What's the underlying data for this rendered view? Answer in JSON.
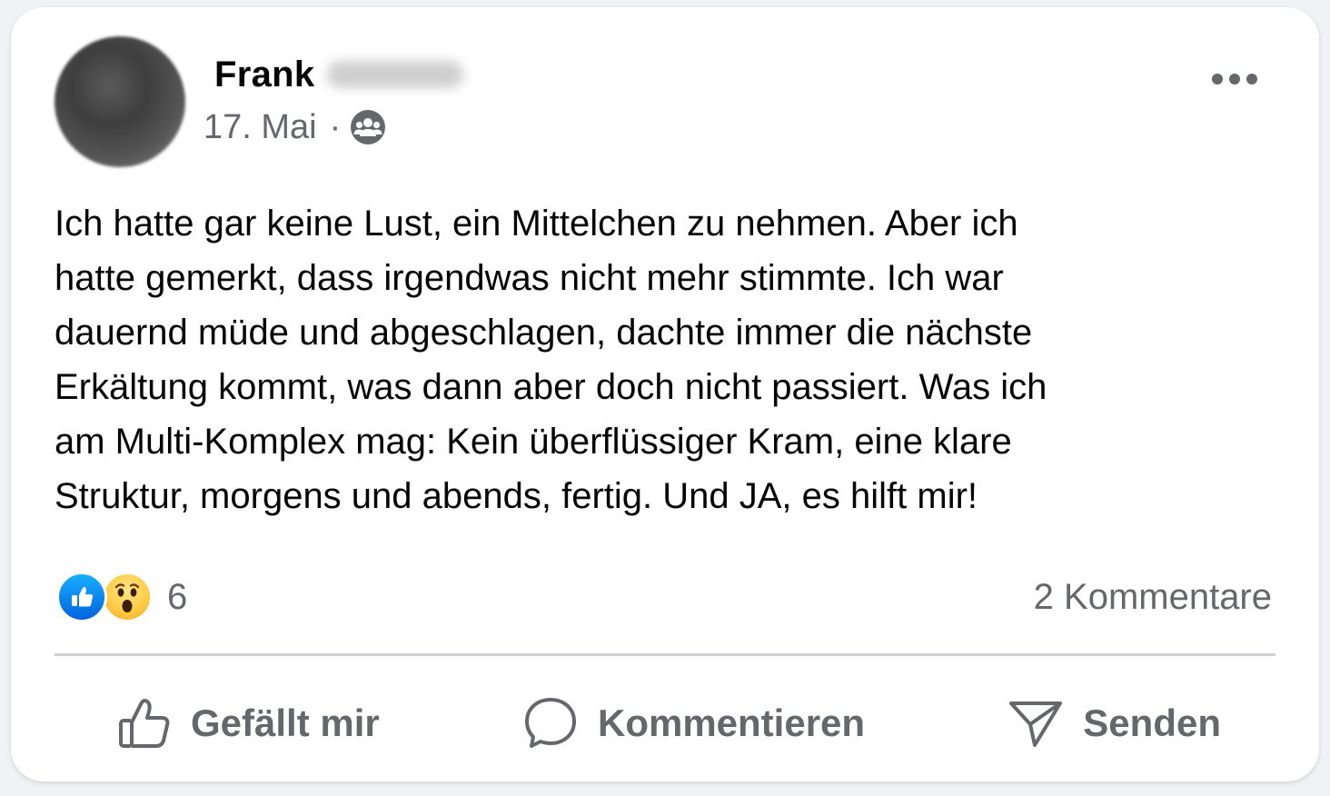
{
  "post": {
    "author_name": "Frank",
    "date": "17. Mai",
    "separator": "·",
    "audience_icon": "friends-icon",
    "more_icon": "more-horizontal-icon",
    "text": "Ich hatte gar keine Lust, ein Mittelchen zu nehmen. Aber ich\nhatte gemerkt, dass irgendwas nicht mehr stimmte. Ich war\ndauernd müde und abgeschlagen, dachte immer die nächste\nErkältung kommt, was dann aber doch nicht passiert. Was ich\nam Multi-Komplex mag: Kein überflüssiger Kram, eine klare\nStruktur, morgens und abends, fertig. Und JA, es hilft mir!"
  },
  "reactions": {
    "icons": [
      "like-reaction-icon",
      "wow-reaction-icon"
    ],
    "count": "6"
  },
  "comments": {
    "label": "2 Kommentare"
  },
  "actions": {
    "like_label": "Gefällt mir",
    "comment_label": "Kommentieren",
    "send_label": "Senden"
  },
  "colors": {
    "text_primary": "#050505",
    "text_secondary": "#65676b",
    "like_blue": "#0866ff",
    "wow_yellow": "#ffcd45",
    "divider": "#ced0d4"
  }
}
